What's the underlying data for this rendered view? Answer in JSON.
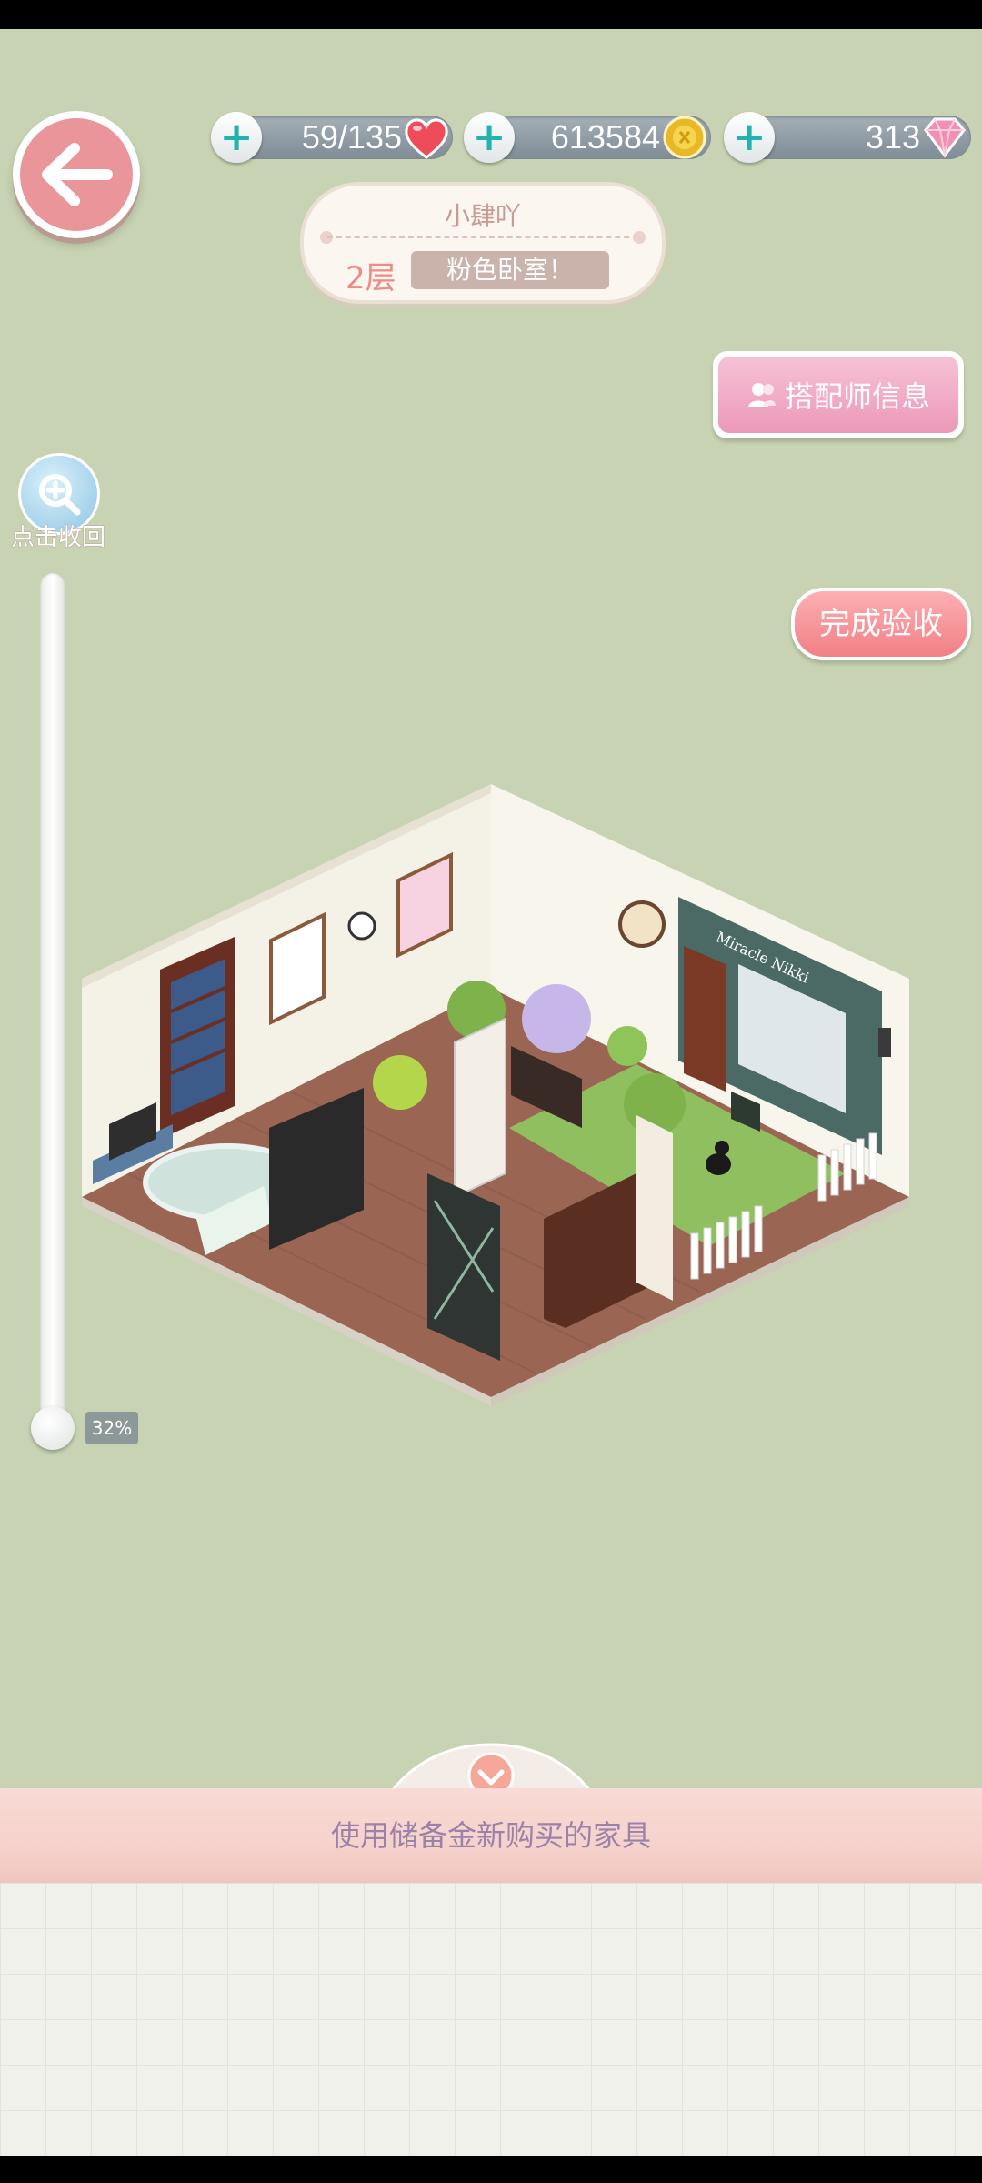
{
  "header": {
    "stamina": {
      "value": "59/135",
      "icon": "heart-icon"
    },
    "coins": {
      "value": "613584",
      "icon": "coin-icon"
    },
    "gems": {
      "value": "313",
      "icon": "diamond-icon"
    }
  },
  "profile": {
    "name": "小肆吖",
    "floor": "2层",
    "room_name": "粉色卧室！"
  },
  "buttons": {
    "designer_info": "搭配师信息",
    "complete": "完成验收"
  },
  "zoom": {
    "label": "点击收回",
    "level_text": "32%",
    "level_fraction": 0.32
  },
  "panel": {
    "banner": "使用储备金新购买的家具"
  },
  "room": {
    "shop_sign": "Miracle Nikki"
  },
  "colors": {
    "background": "#c7d3b2",
    "back_button": "#e9959a",
    "designer_button": "#ec98b9",
    "complete_button": "#f17f86",
    "plus": "#22b3b0"
  }
}
